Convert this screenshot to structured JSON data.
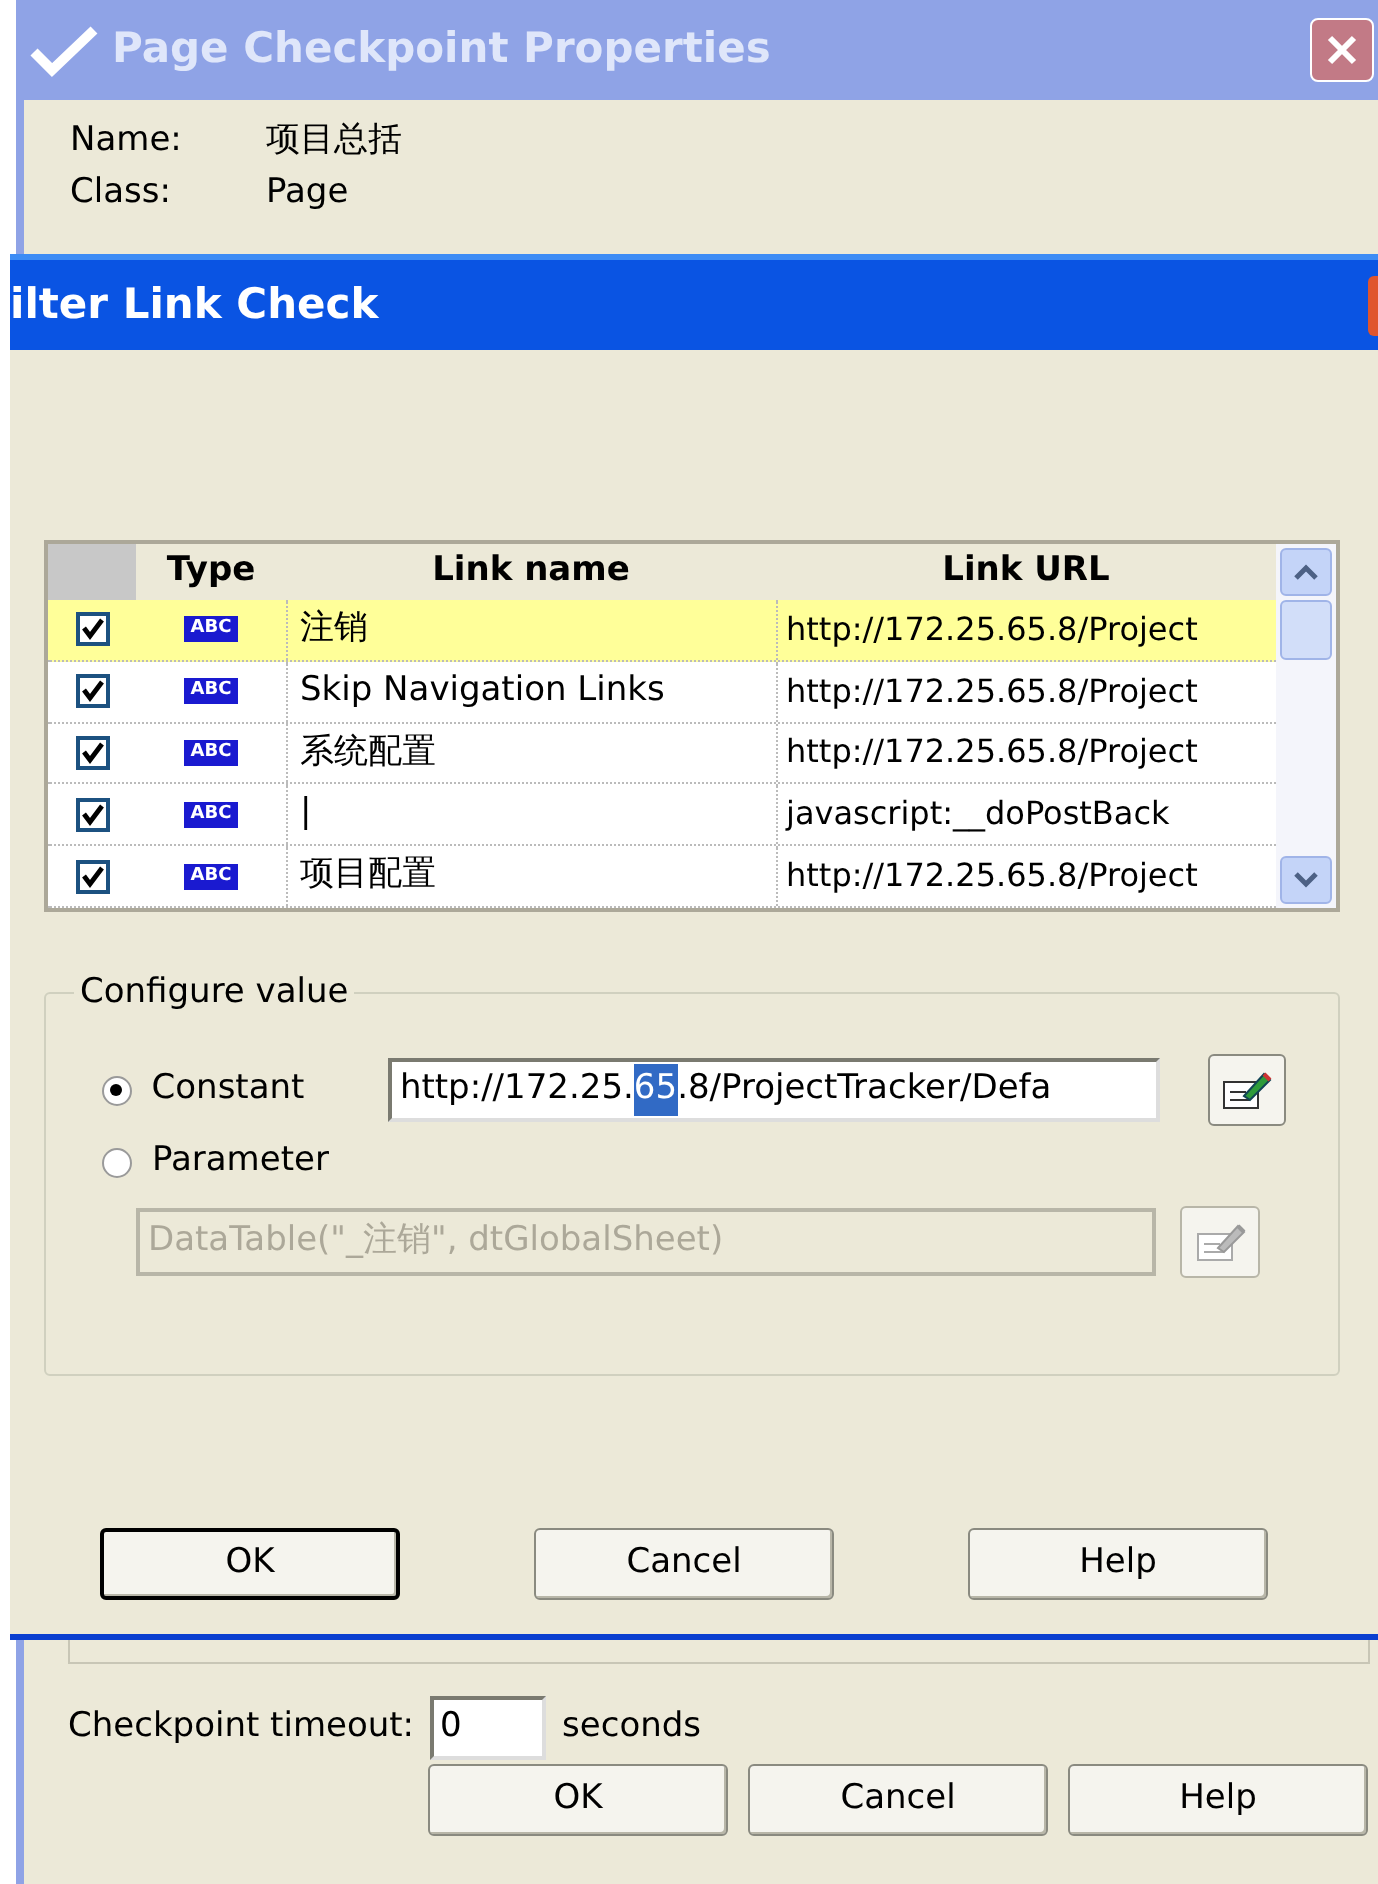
{
  "back_window": {
    "title": "Page Checkpoint Properties",
    "active": false,
    "fields": [
      {
        "label": "Name:",
        "value": "项目总括"
      },
      {
        "label": "Class:",
        "value": "Page"
      }
    ],
    "timeout": {
      "label": "Checkpoint timeout:",
      "value": "0",
      "unit": "seconds"
    },
    "buttons": [
      {
        "label": "OK"
      },
      {
        "label": "Cancel"
      },
      {
        "label": "Help"
      }
    ]
  },
  "front_window": {
    "title": "ilter Link Check",
    "active": true,
    "table": {
      "columns": [
        "Type",
        "Link name",
        "Link URL"
      ],
      "rows": [
        {
          "checked": true,
          "selected": true,
          "type": "ABC",
          "name": "注销",
          "url": "http://172.25.65.8/Project"
        },
        {
          "checked": true,
          "selected": false,
          "type": "ABC",
          "name": "Skip Navigation Links",
          "url": "http://172.25.65.8/Project"
        },
        {
          "checked": true,
          "selected": false,
          "type": "ABC",
          "name": "系统配置",
          "url": "http://172.25.65.8/Project"
        },
        {
          "checked": true,
          "selected": false,
          "type": "ABC",
          "name": "|",
          "url": "javascript:__doPostBack"
        },
        {
          "checked": true,
          "selected": false,
          "type": "ABC",
          "name": "项目配置",
          "url": "http://172.25.65.8/Project"
        }
      ]
    },
    "configure": {
      "title": "Configure value",
      "options": [
        {
          "label": "Constant",
          "selected": true,
          "disabled": false,
          "value_before": "http://172.25.",
          "value_selected": "65",
          "value_after": ".8/ProjectTracker/Defa"
        },
        {
          "label": "Parameter",
          "selected": false,
          "disabled": true,
          "value_before": "DataTable(\"_注销\", dtGlobalSheet)"
        }
      ]
    },
    "buttons": [
      {
        "label": "OK",
        "default": true
      },
      {
        "label": "Cancel",
        "default": false
      },
      {
        "label": "Help",
        "default": false
      }
    ]
  }
}
